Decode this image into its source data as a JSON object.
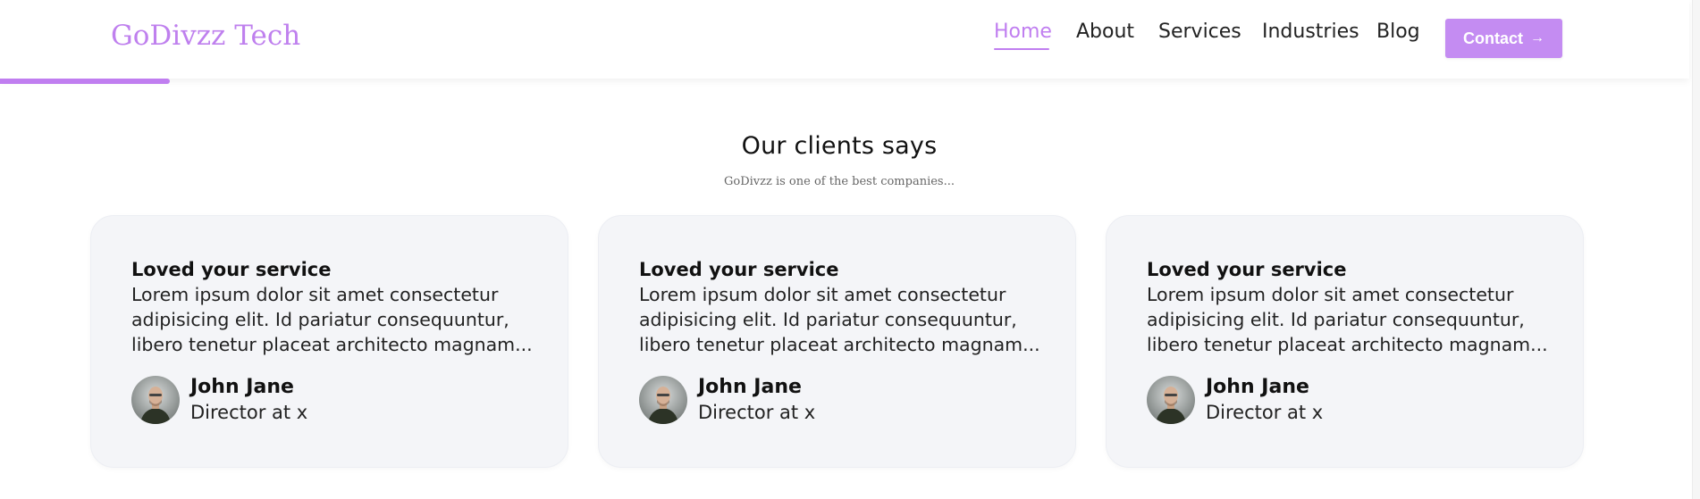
{
  "header": {
    "logo": "GoDivzz Tech",
    "nav": [
      "Home",
      "About",
      "Services",
      "Industries",
      "Blog"
    ],
    "active_nav": "Home",
    "contact_label": "Contact",
    "contact_arrow": "→"
  },
  "colors": {
    "accent": "#c07ef0",
    "card_bg": "#f4f5f8"
  },
  "testimonials_section": {
    "title": "Our clients says",
    "subtitle": "GoDivzz is one of the best companies...",
    "cards": [
      {
        "title": "Loved your service",
        "text": "Lorem ipsum dolor sit amet consectetur adipisicing elit. Id pariatur consequuntur, libero tenetur placeat architecto magnam...",
        "name": "John Jane",
        "role": "Director at x"
      },
      {
        "title": "Loved your service",
        "text": "Lorem ipsum dolor sit amet consectetur adipisicing elit. Id pariatur consequuntur, libero tenetur placeat architecto magnam...",
        "name": "John Jane",
        "role": "Director at x"
      },
      {
        "title": "Loved your service",
        "text": "Lorem ipsum dolor sit amet consectetur adipisicing elit. Id pariatur consequuntur, libero tenetur placeat architecto magnam...",
        "name": "John Jane",
        "role": "Director at x"
      }
    ]
  }
}
